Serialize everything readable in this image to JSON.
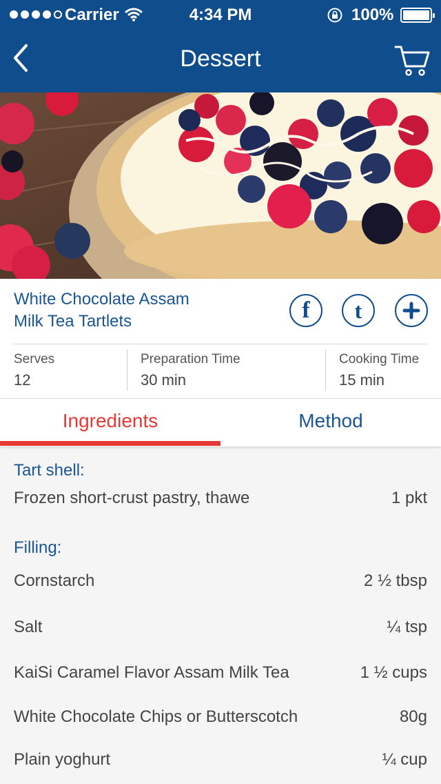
{
  "status_bar": {
    "carrier": "Carrier",
    "time": "4:34 PM",
    "battery_pct": "100%",
    "signal_dots": 5,
    "signal_filled": 4
  },
  "nav": {
    "title": "Dessert",
    "back_icon": "chevron-left-icon",
    "cart_icon": "shopping-cart-icon"
  },
  "recipe": {
    "title_line1": "White Chocolate Assam",
    "title_line2": "Milk Tea Tartlets",
    "share": {
      "facebook": "f",
      "tumblr": "t"
    },
    "serves_label": "Serves",
    "serves_value": "12",
    "prep_label": "Preparation Time",
    "prep_value": "30 min",
    "cook_label": "Cooking Time",
    "cook_value": "15 min"
  },
  "tabs": {
    "ingredients": "Ingredients",
    "method": "Method",
    "active": "ingredients"
  },
  "ingredients": {
    "section1_title": "Tart shell:",
    "section1_items": [
      {
        "name": "Frozen short-crust pastry, thawe",
        "qty": "1 pkt"
      }
    ],
    "section2_title": "Filling:",
    "section2_items": [
      {
        "name": "Cornstarch",
        "qty": "2 ½ tbsp"
      },
      {
        "name": "Salt",
        "qty": "¼ tsp"
      },
      {
        "name": "KaiSi Caramel Flavor Assam Milk Tea",
        "qty": "1 ½ cups"
      },
      {
        "name": "White Chocolate Chips or Butterscotch",
        "qty": "80g"
      },
      {
        "name": "Plain yoghurt",
        "qty": "¼ cup"
      }
    ]
  },
  "colors": {
    "brand_blue": "#0f4d8c",
    "link_blue": "#1a5594",
    "accent_red": "#e53935"
  }
}
